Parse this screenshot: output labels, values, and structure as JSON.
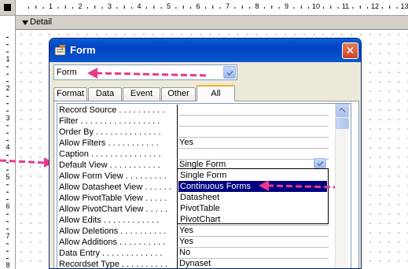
{
  "ruler": {
    "h_numbers": [
      "1",
      "2",
      "3",
      "4",
      "5",
      "6",
      "7",
      "8",
      "9",
      "10",
      "11",
      "12",
      "13"
    ],
    "v_numbers": [
      "1",
      "2",
      "3",
      "4",
      "5",
      "6",
      "7",
      "8"
    ]
  },
  "section": {
    "label": "Detail"
  },
  "dialog": {
    "title": "Form",
    "close_glyph": "✕",
    "object_select": {
      "value": "Form"
    },
    "tabs": [
      "Format",
      "Data",
      "Event",
      "Other",
      "All"
    ],
    "active_tab": "All",
    "properties": [
      {
        "name": "Record Source . . . . . . . . . .",
        "value": ""
      },
      {
        "name": "Filter . . . . . . . . . . . . . . . . .",
        "value": ""
      },
      {
        "name": "Order By . . . . . . . . . . . . . .",
        "value": ""
      },
      {
        "name": "Allow Filters . . . . . . . . . . .",
        "value": "Yes"
      },
      {
        "name": "Caption . . . . . . . . . . . . . . .",
        "value": ""
      },
      {
        "name": "Default View . . . . . . . . . . .",
        "value": "Single Form"
      },
      {
        "name": "Allow Form View . . . . . . . . .",
        "value": ""
      },
      {
        "name": "Allow Datasheet View . . . . . .",
        "value": ""
      },
      {
        "name": "Allow PivotTable View . . . . .",
        "value": ""
      },
      {
        "name": "Allow PivotChart View . . . . .",
        "value": ""
      },
      {
        "name": "Allow Edits . . . . . . . . . . . .",
        "value": ""
      },
      {
        "name": "Allow Deletions . . . . . . . . . .",
        "value": "Yes"
      },
      {
        "name": "Allow Additions . . . . . . . . . .",
        "value": "Yes"
      },
      {
        "name": "Data Entry . . . . . . . . . . . . .",
        "value": "No"
      },
      {
        "name": "Recordset Type . . . . . . . . . .",
        "value": "Dynaset"
      }
    ],
    "default_view_dropdown": {
      "options": [
        "Single Form",
        "Continuous Forms",
        "Datasheet",
        "PivotTable",
        "PivotChart"
      ],
      "highlighted": "Continuous Forms"
    }
  },
  "colors": {
    "annotation_arrow": "#e8388a",
    "title_bar": "#0041c0",
    "selection": "#000080"
  }
}
